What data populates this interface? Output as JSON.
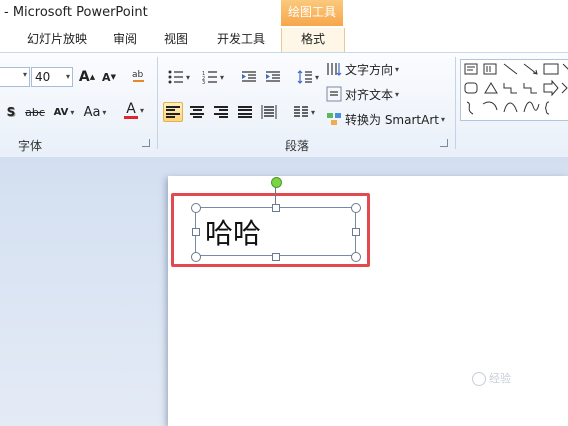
{
  "window": {
    "title": "- Microsoft PowerPoint"
  },
  "contextual": {
    "header": "绘图工具"
  },
  "tabs": [
    {
      "label": "幻灯片放映"
    },
    {
      "label": "审阅"
    },
    {
      "label": "视图"
    },
    {
      "label": "开发工具"
    },
    {
      "label": "格式"
    }
  ],
  "font_group": {
    "label": "字体",
    "font_size": "40",
    "grow_font_label": "A",
    "shrink_font_label": "A",
    "shadow_label": "S",
    "strike_label": "abc",
    "spacing_label": "AV",
    "case_label": "Aa",
    "color_label": "A",
    "font_color": "#e0262b"
  },
  "paragraph_group": {
    "label": "段落",
    "text_direction": "文字方向",
    "align_text": "对齐文本",
    "convert_smartart": "转换为 SmartArt"
  },
  "slide": {
    "textbox_text": "哈哈",
    "highlight_color": "#e24a4f"
  },
  "watermark": {
    "text": "经验"
  }
}
